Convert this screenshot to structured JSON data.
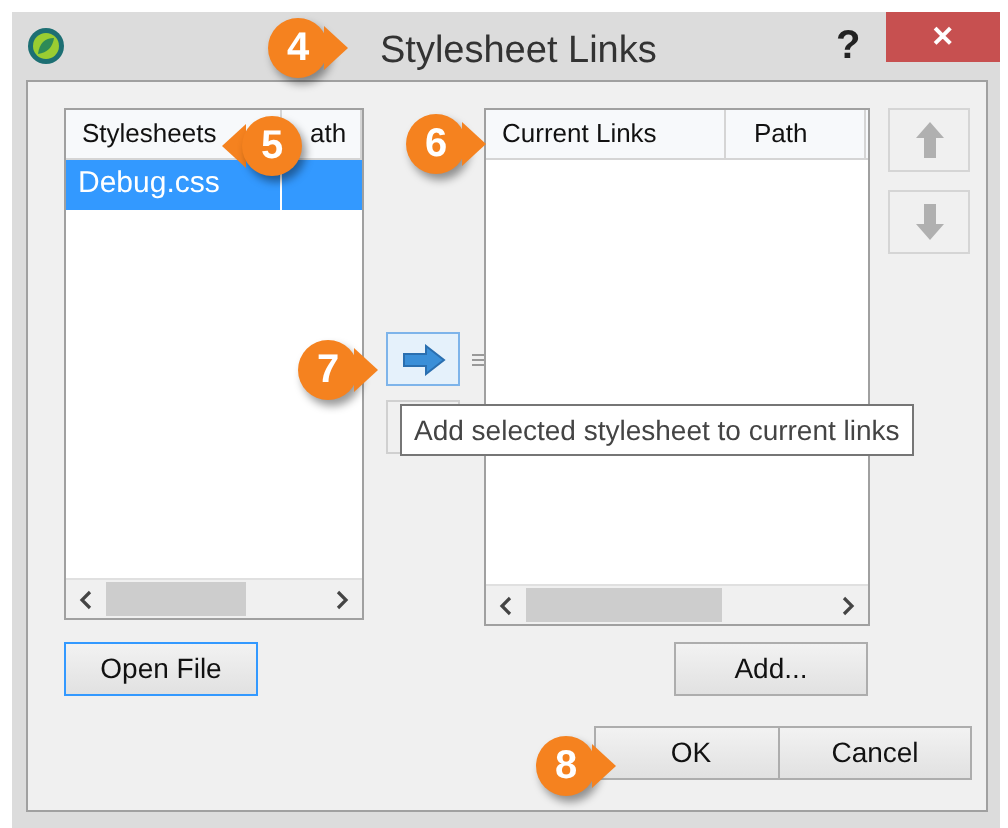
{
  "window": {
    "title": "Stylesheet Links",
    "help": "?",
    "close": "✕"
  },
  "stylesheets": {
    "columns": [
      "Stylesheets",
      "ath"
    ],
    "rows": [
      {
        "name": "Debug.css",
        "selected": true
      }
    ]
  },
  "transfer_button": {
    "tooltip": "Add selected stylesheet to current links"
  },
  "current_links": {
    "columns": [
      "Current Links",
      "Path"
    ]
  },
  "buttons": {
    "open_file": "Open File",
    "add": "Add...",
    "ok": "OK",
    "cancel": "Cancel"
  },
  "callouts": [
    {
      "label": "4"
    },
    {
      "label": "5"
    },
    {
      "label": "6"
    },
    {
      "label": "7"
    },
    {
      "label": "8"
    }
  ]
}
